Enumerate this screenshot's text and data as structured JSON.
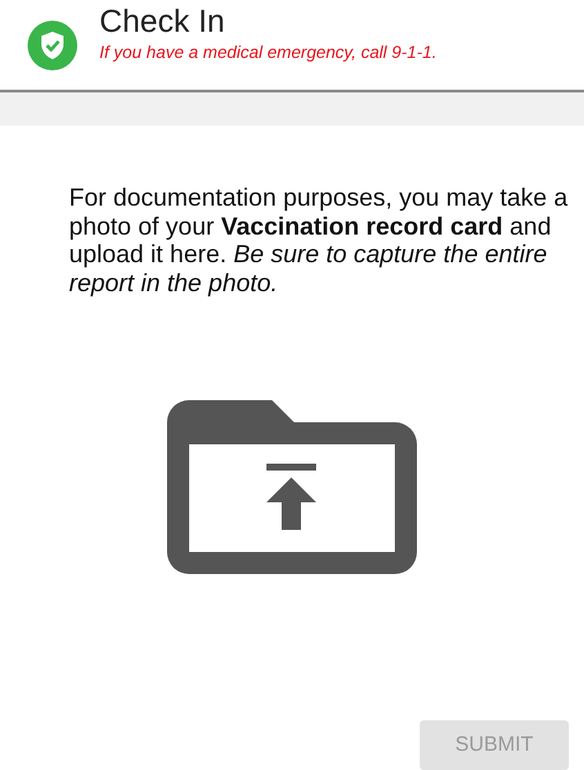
{
  "header": {
    "title": "Check In",
    "subtitle": "If you have a medical emergency, call 9-1-1."
  },
  "instructions": "For documentation purposes, you may take a photo of your **Vaccination record card** and upload it here. *Be sure to capture the entire report in the photo.*",
  "submit": {
    "label": "SUBMIT",
    "disabled": true
  }
}
